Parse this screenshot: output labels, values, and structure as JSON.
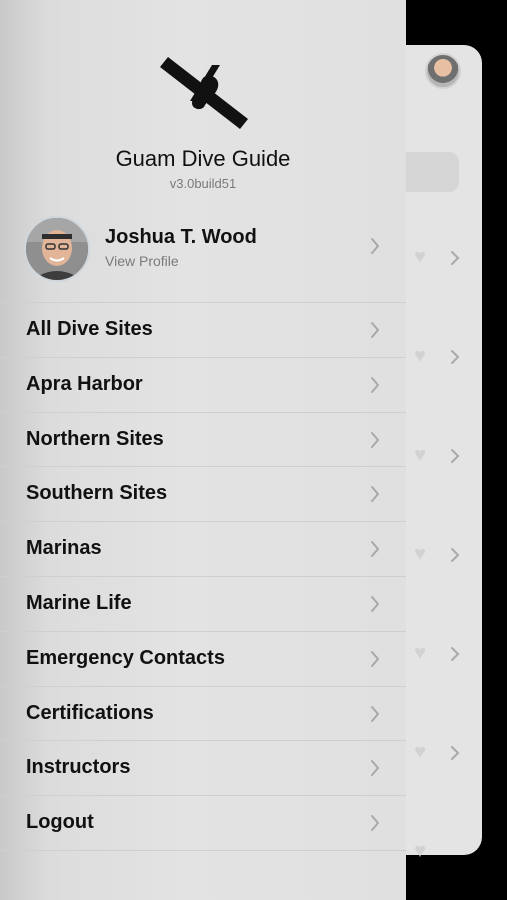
{
  "app": {
    "title": "Guam Dive Guide",
    "version": "v3.0build51"
  },
  "profile": {
    "name": "Joshua T. Wood",
    "subtitle": "View Profile"
  },
  "menu": {
    "items": [
      {
        "label": "All Dive Sites"
      },
      {
        "label": "Apra Harbor"
      },
      {
        "label": "Northern Sites"
      },
      {
        "label": "Southern Sites"
      },
      {
        "label": "Marinas"
      },
      {
        "label": "Marine Life"
      },
      {
        "label": "Emergency Contacts"
      },
      {
        "label": "Certifications"
      },
      {
        "label": "Instructors"
      },
      {
        "label": "Logout"
      }
    ]
  },
  "icons": {
    "logo": "guam-satellite-logo",
    "row_arrow": "chevron-right-icon",
    "favorite": "heart-icon"
  },
  "colors": {
    "drawer_background": "#e0e0e0",
    "text": "#111111",
    "secondary_text": "#7a7a7a",
    "chevron": "#a8a8a8"
  }
}
